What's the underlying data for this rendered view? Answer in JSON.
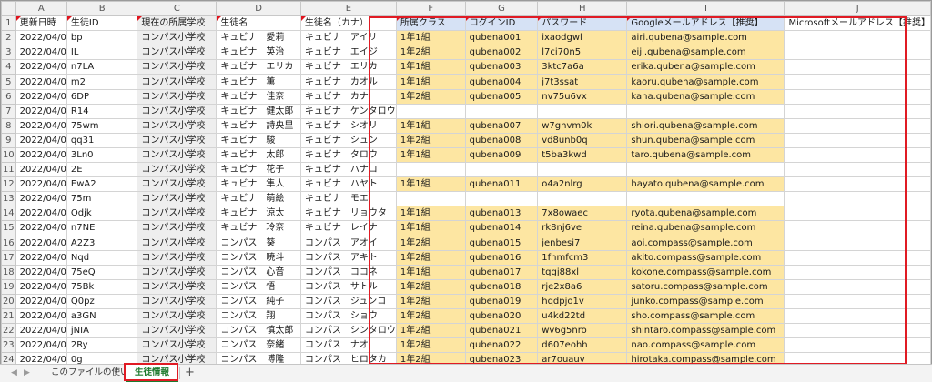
{
  "columns": [
    "A",
    "B",
    "C",
    "D",
    "E",
    "F",
    "G",
    "H",
    "I",
    "J"
  ],
  "headers": [
    "更新日時",
    "生徒ID",
    "現在の所属学校",
    "生徒名",
    "生徒名（カナ）",
    "所属クラス",
    "ログインID",
    "パスワード",
    "Googleメールアドレス【推奨】",
    "Microsoftメールアドレス【推奨】"
  ],
  "rows": [
    [
      "2022/04/0",
      "bp",
      "コンパス小学校",
      "キュビナ　愛莉",
      "キュビナ　アイリ",
      "1年1組",
      "qubena001",
      "ixaodgwl",
      "airi.qubena@sample.com",
      ""
    ],
    [
      "2022/04/0",
      "IL",
      "コンパス小学校",
      "キュビナ　英治",
      "キュビナ　エイジ",
      "1年2組",
      "qubena002",
      "l7ci70n5",
      "eiji.qubena@sample.com",
      ""
    ],
    [
      "2022/04/0",
      "n7LA",
      "コンパス小学校",
      "キュビナ　エリカ",
      "キュビナ　エリカ",
      "1年1組",
      "qubena003",
      "3ktc7a6a",
      "erika.qubena@sample.com",
      ""
    ],
    [
      "2022/04/0",
      "m2",
      "コンパス小学校",
      "キュビナ　薫",
      "キュビナ　カオル",
      "1年1組",
      "qubena004",
      "j7t3ssat",
      "kaoru.qubena@sample.com",
      ""
    ],
    [
      "2022/04/0",
      "6DP",
      "コンパス小学校",
      "キュビナ　佳奈",
      "キュビナ　カナ",
      "1年2組",
      "qubena005",
      "nv75u6vx",
      "kana.qubena@sample.com",
      ""
    ],
    [
      "2022/04/0",
      "R14",
      "コンパス小学校",
      "キュビナ　健太郎",
      "キュビナ　ケンタロウ",
      "",
      "",
      "",
      "",
      ""
    ],
    [
      "2022/04/0",
      "75wm",
      "コンパス小学校",
      "キュビナ　詩央里",
      "キュビナ　シオリ",
      "1年1組",
      "qubena007",
      "w7ghvm0k",
      "shiori.qubena@sample.com",
      ""
    ],
    [
      "2022/04/0",
      "qq31",
      "コンパス小学校",
      "キュビナ　駿",
      "キュビナ　シュン",
      "1年2組",
      "qubena008",
      "vd8unb0q",
      "shun.qubena@sample.com",
      ""
    ],
    [
      "2022/04/0",
      "3Ln0",
      "コンパス小学校",
      "キュビナ　太郎",
      "キュビナ　タロウ",
      "1年1組",
      "qubena009",
      "t5ba3kwd",
      "taro.qubena@sample.com",
      ""
    ],
    [
      "2022/04/0",
      "2E",
      "コンパス小学校",
      "キュビナ　花子",
      "キュビナ　ハナコ",
      "",
      "",
      "",
      "",
      ""
    ],
    [
      "2022/04/0",
      "EwA2",
      "コンパス小学校",
      "キュビナ　隼人",
      "キュビナ　ハヤト",
      "1年1組",
      "qubena011",
      "o4a2nlrg",
      "hayato.qubena@sample.com",
      ""
    ],
    [
      "2022/04/0",
      "75m",
      "コンパス小学校",
      "キュビナ　萌絵",
      "キュビナ　モエ",
      "",
      "",
      "",
      "",
      ""
    ],
    [
      "2022/04/0",
      "Odjk",
      "コンパス小学校",
      "キュビナ　涼太",
      "キュビナ　リョウタ",
      "1年1組",
      "qubena013",
      "7x8owaec",
      "ryota.qubena@sample.com",
      ""
    ],
    [
      "2022/04/0",
      "n7NE",
      "コンパス小学校",
      "キュビナ　玲奈",
      "キュビナ　レイナ",
      "1年1組",
      "qubena014",
      "rk8nj6ve",
      "reina.qubena@sample.com",
      ""
    ],
    [
      "2022/04/0",
      "A2Z3",
      "コンパス小学校",
      "コンパス　葵",
      "コンパス　アオイ",
      "1年2組",
      "qubena015",
      "jenbesi7",
      "aoi.compass@sample.com",
      ""
    ],
    [
      "2022/04/0",
      "Nqd",
      "コンパス小学校",
      "コンパス　暁斗",
      "コンパス　アキト",
      "1年2組",
      "qubena016",
      "1fhmfcm3",
      "akito.compass@sample.com",
      ""
    ],
    [
      "2022/04/0",
      "75eQ",
      "コンパス小学校",
      "コンパス　心音",
      "コンパス　ココネ",
      "1年1組",
      "qubena017",
      "tqgj88xl",
      "kokone.compass@sample.com",
      ""
    ],
    [
      "2022/04/0",
      "75Bk",
      "コンパス小学校",
      "コンパス　悟",
      "コンパス　サトル",
      "1年2組",
      "qubena018",
      "rje2x8a6",
      "satoru.compass@sample.com",
      ""
    ],
    [
      "2022/04/0",
      "Q0pz",
      "コンパス小学校",
      "コンパス　純子",
      "コンパス　ジュンコ",
      "1年2組",
      "qubena019",
      "hqdpjo1v",
      "junko.compass@sample.com",
      ""
    ],
    [
      "2022/04/0",
      "a3GN",
      "コンパス小学校",
      "コンパス　翔",
      "コンパス　ショウ",
      "1年2組",
      "qubena020",
      "u4kd22td",
      "sho.compass@sample.com",
      ""
    ],
    [
      "2022/04/0",
      "jNIA",
      "コンパス小学校",
      "コンパス　慎太郎",
      "コンパス　シンタロウ",
      "1年2組",
      "qubena021",
      "wv6g5nro",
      "shintaro.compass@sample.com",
      ""
    ],
    [
      "2022/04/0",
      "2Ry",
      "コンパス小学校",
      "コンパス　奈緒",
      "コンパス　ナオ",
      "1年2組",
      "qubena022",
      "d607eohh",
      "nao.compass@sample.com",
      ""
    ],
    [
      "2022/04/0",
      "0g",
      "コンパス小学校",
      "コンパス　博隆",
      "コンパス　ヒロタカ",
      "1年2組",
      "qubena023",
      "ar7ouauv",
      "hirotaka.compass@sample.com",
      ""
    ]
  ],
  "sheet_tabs": {
    "usage": "このファイルの使い方",
    "active": "生徒情報",
    "add": "+"
  },
  "colors": {
    "highlight": "#fde6a2",
    "header_highlight": "#d6e2f5",
    "annotation_box": "#e01b24",
    "active_tab": "#1e7a2e"
  }
}
